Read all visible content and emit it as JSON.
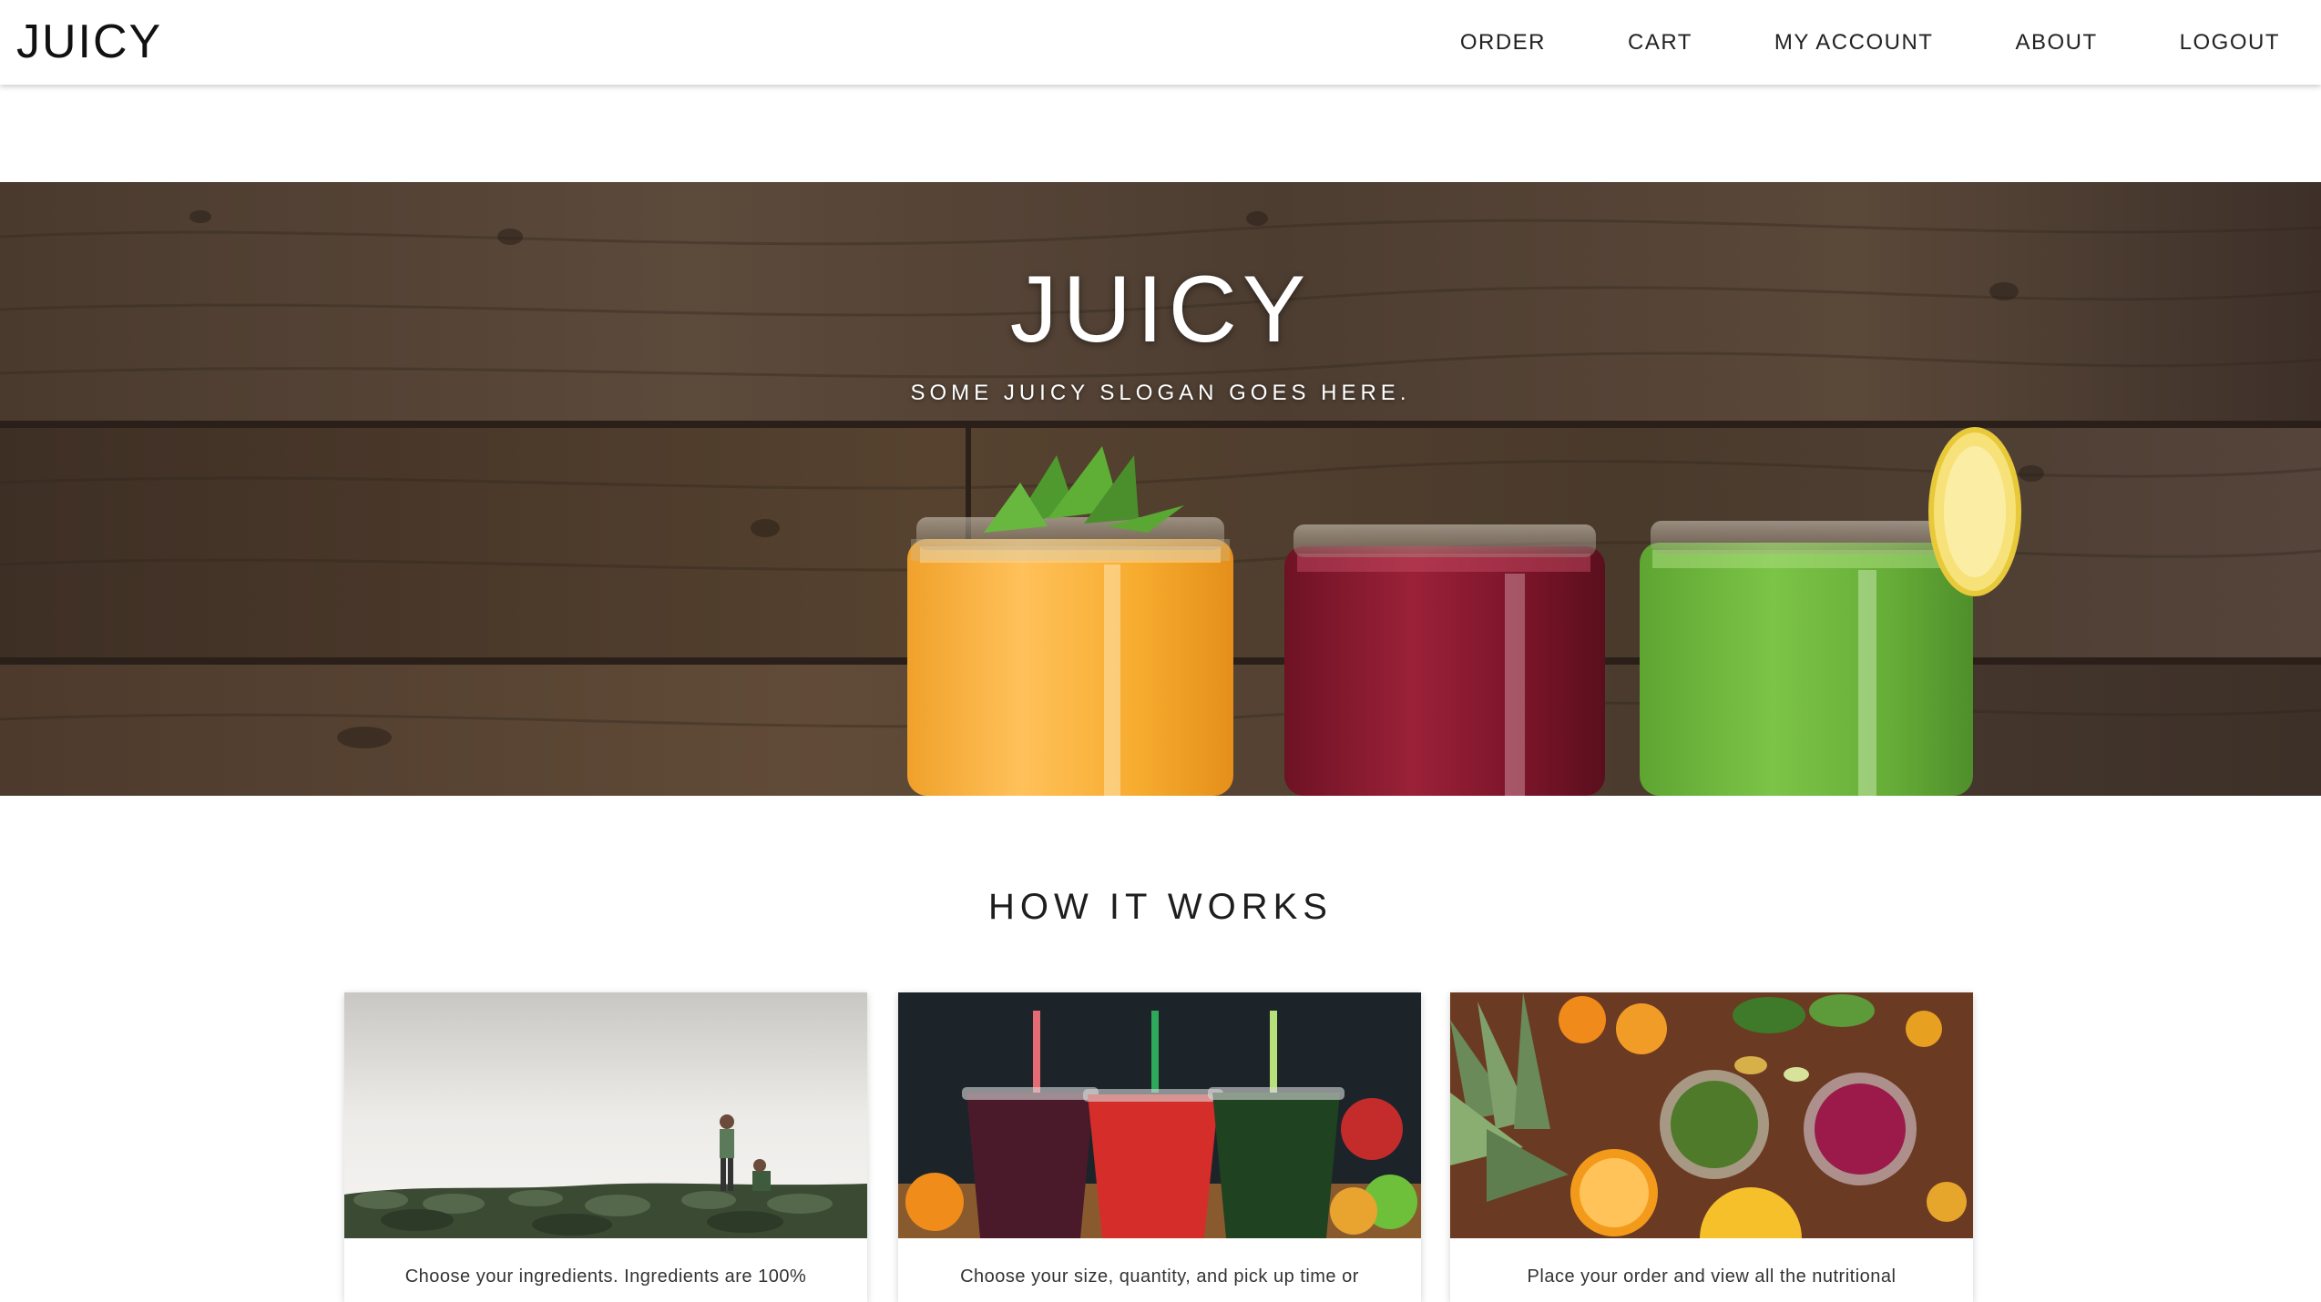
{
  "brand": "JUICY",
  "nav": {
    "order": "ORDER",
    "cart": "CART",
    "my_account": "MY ACCOUNT",
    "about": "ABOUT",
    "logout": "LOGOUT"
  },
  "hero": {
    "title": "JUICY",
    "slogan": "SOME JUICY SLOGAN GOES HERE."
  },
  "how_it_works": {
    "title": "HOW IT WORKS",
    "steps": [
      {
        "text": "Choose your ingredients. Ingredients are 100%"
      },
      {
        "text": "Choose your size, quantity, and pick up time or"
      },
      {
        "text": "Place your order and view all the nutritional"
      }
    ]
  },
  "colors": {
    "wood_dark": "#3a2c22",
    "wood_mid": "#5a4636",
    "orange_juice": "#f5a623",
    "red_juice": "#8b1a2e",
    "green_juice": "#6ab23a",
    "text": "#222222"
  }
}
